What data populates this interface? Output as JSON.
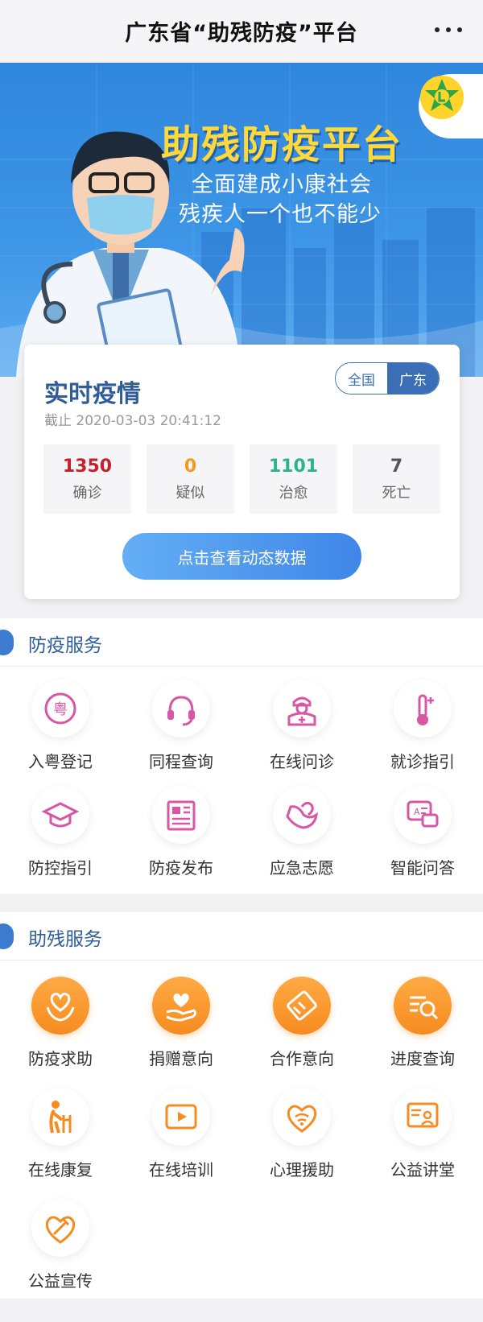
{
  "app": {
    "title": "广东省“助残防疫”平台"
  },
  "banner": {
    "headline": "助残防疫平台",
    "subtitle_line1": "全面建成小康社会",
    "subtitle_line2": "残疾人一个也不能少",
    "logo_icon": "disability-federation-logo-icon"
  },
  "stats": {
    "title": "实时疫情",
    "timestamp": "截止 2020-03-03 20:41:12",
    "scope_options": [
      "全国",
      "广东"
    ],
    "selected_scope": "广东",
    "items": [
      {
        "value": "1350",
        "label": "确诊",
        "color": "#c8202a"
      },
      {
        "value": "0",
        "label": "疑似",
        "color": "#f29a1e"
      },
      {
        "value": "1101",
        "label": "治愈",
        "color": "#2bb38f"
      },
      {
        "value": "7",
        "label": "死亡",
        "color": "#555555"
      }
    ],
    "cta_label": "点击查看动态数据"
  },
  "services": {
    "prevention": {
      "title": "防疫服务",
      "accent": "#d856a6",
      "items": [
        {
          "label": "入粤登记",
          "icon": "yue-registration-icon"
        },
        {
          "label": "同程查询",
          "icon": "headset-icon"
        },
        {
          "label": "在线问诊",
          "icon": "doctor-icon"
        },
        {
          "label": "就诊指引",
          "icon": "thermometer-icon"
        },
        {
          "label": "防控指引",
          "icon": "graduation-cap-icon"
        },
        {
          "label": "防疫发布",
          "icon": "newspaper-icon"
        },
        {
          "label": "应急志愿",
          "icon": "helping-hand-icon"
        },
        {
          "label": "智能问答",
          "icon": "chat-qa-icon"
        }
      ]
    },
    "assistance": {
      "title": "助残服务",
      "accent": "#f68b1f",
      "items": [
        {
          "label": "防疫求助",
          "icon": "help-heart-icon"
        },
        {
          "label": "捐赠意向",
          "icon": "donation-hand-icon"
        },
        {
          "label": "合作意向",
          "icon": "handshake-icon"
        },
        {
          "label": "进度查询",
          "icon": "progress-search-icon"
        },
        {
          "label": "在线康复",
          "icon": "walker-icon"
        },
        {
          "label": "在线培训",
          "icon": "video-play-icon"
        },
        {
          "label": "心理援助",
          "icon": "heart-signal-icon"
        },
        {
          "label": "公益讲堂",
          "icon": "lecture-screen-icon"
        },
        {
          "label": "公益宣传",
          "icon": "heart-syringe-icon"
        }
      ]
    }
  }
}
